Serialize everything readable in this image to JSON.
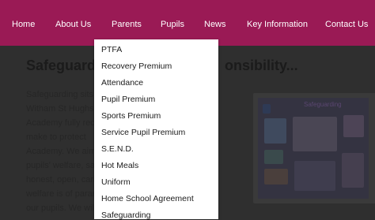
{
  "nav": {
    "items": [
      {
        "label": "Home"
      },
      {
        "label": "About Us"
      },
      {
        "label": "Parents"
      },
      {
        "label": "Pupils"
      },
      {
        "label": "News"
      },
      {
        "label": "Key Information"
      },
      {
        "label": "Contact Us"
      }
    ],
    "active": "Parents"
  },
  "page": {
    "title_left": "Safeguardi",
    "title_right": "onsibility...",
    "body_lines": [
      "Safeguarding sits a",
      "Witham St Hughs A",
      "Academy fully reco",
      "make to protect ",
      "Academy. We aim",
      "pupils' welfare, saf",
      "honest, open, cari",
      "welfare is of paran",
      "our pupils. We will"
    ],
    "poster_title": "Safeguarding"
  },
  "dropdown": {
    "items": [
      {
        "label": "PTFA"
      },
      {
        "label": "Recovery Premium"
      },
      {
        "label": "Attendance"
      },
      {
        "label": "Pupil Premium"
      },
      {
        "label": "Sports Premium"
      },
      {
        "label": "Service Pupil Premium"
      },
      {
        "label": "S.E.N.D."
      },
      {
        "label": "Hot Meals"
      },
      {
        "label": "Uniform"
      },
      {
        "label": "Home School Agreement"
      },
      {
        "label": "Safeguarding"
      }
    ]
  },
  "colors": {
    "nav_bg": "#9a1a55",
    "overlay_bg": "#2f2f2f",
    "dropdown_bg": "#ffffff"
  }
}
